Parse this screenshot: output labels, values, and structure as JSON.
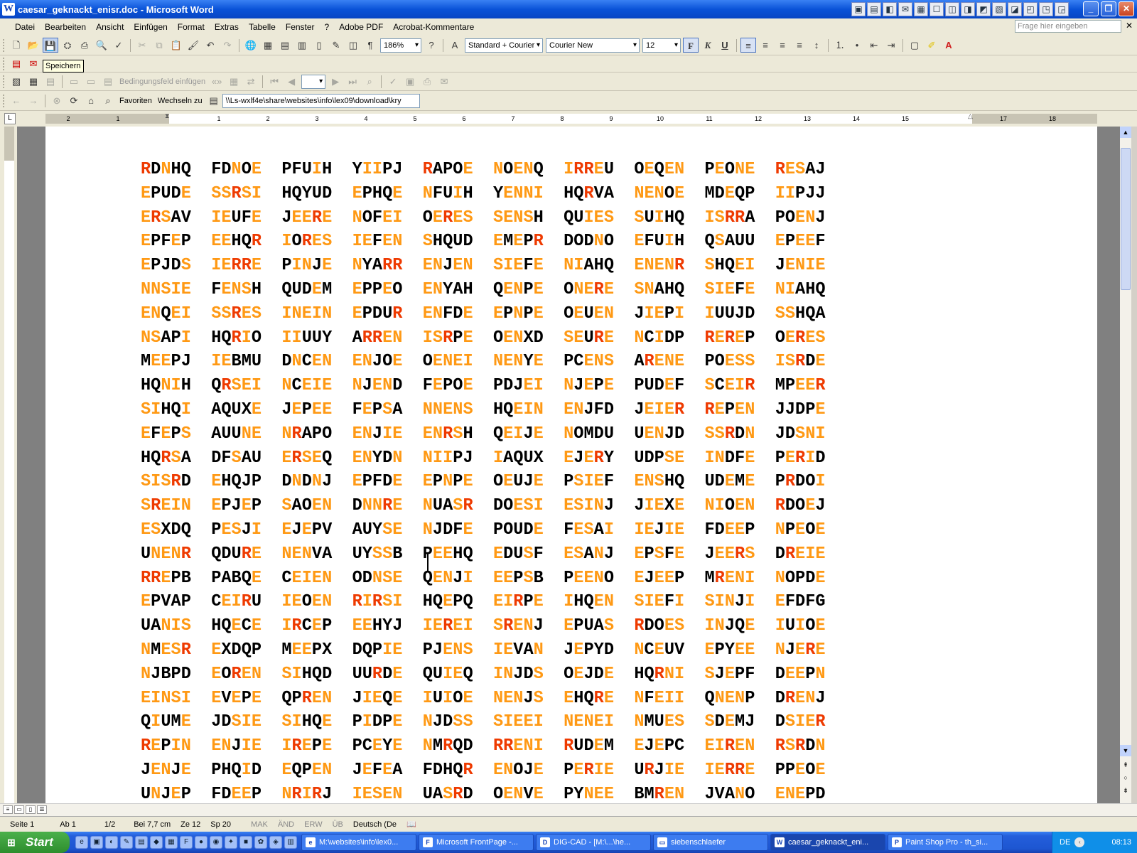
{
  "window": {
    "title": "caesar_geknackt_enisr.doc - Microsoft Word"
  },
  "menu": [
    "Datei",
    "Bearbeiten",
    "Ansicht",
    "Einfügen",
    "Format",
    "Extras",
    "Tabelle",
    "Fenster",
    "?",
    "Adobe PDF",
    "Acrobat-Kommentare"
  ],
  "ask_placeholder": "Frage hier eingeben",
  "toolbar": {
    "zoom": "186%",
    "style": "Standard + Courier",
    "font": "Courier New",
    "size": "12"
  },
  "tooltip": "Speichern",
  "mailmerge": {
    "field_label": "Bedingungsfeld einfügen"
  },
  "web": {
    "favorites": "Favoriten",
    "goto": "Wechseln zu",
    "address": "\\\\Ls-wxlf4e\\share\\websites\\info\\lex09\\download\\kry"
  },
  "ruler_numbers": [
    "2",
    "1",
    "1",
    "2",
    "3",
    "4",
    "5",
    "6",
    "7",
    "8",
    "9",
    "10",
    "11",
    "12",
    "13",
    "14",
    "15",
    "16",
    "17",
    "18"
  ],
  "colors": {
    "orange": "#ff9914",
    "red": "#ee3a00",
    "black": "#000000"
  },
  "cipher_rows": [
    "RDNHQ FDNOE PFUIH YIIPJ RAPOE NOENQ IRREU OEQEN PEONE RESAJ",
    "EPUDE SSRSI HQYUD EPHQE NFUIH YENNI HQRVA NENOE MDEQP IIPJJ",
    "ERSAV IEUFE JEERE NOFEI OERES SENSH QUIES SUIHQ ISRRA POENJ",
    "EPFEP EEHQR IORES IEFEN SHQUD EMEPR DODNO EFUIH QSAUU EPEEF",
    "EPJDS IERRE PINJE NYARR ENJEN SIEFE NIAHQ ENENR SHQEI JENIE",
    "NNSIE FENSH QUDEM EPPEO ENYAH QENPE ONERE SNAHQ SIEFE NIAHQ",
    "ENQEI SSRES INEIN EPDUR ENFDE EPNPE OEUEN JIEPI IUUJD SSHQA",
    "NSAPI HQRIO IIUUY ARREN ISRPE OENXD SEURE NCIDP REREP OERES",
    "MEEPJ IEBMU DNCEN ENJOE OENEI NENYE PCENS ARENE POESS ISRDE",
    "HQNIH QRSEI NCEIE NJEND FEPOE PDJEI NJEPE PUDEF SCEIR MPEER",
    "SIHQI AQUXE JEPEE FEPSA NNENS HQEIN ENJFD JEIER REPEN JJDPE",
    "EFEPS AUUNE NRAPO ENJIE ENRSH QEIJE NOMDU UENJD SSRDN JDSNI",
    "HQRSA DFSAU ERSEQ ENYDN NIIPJ IAQUX EJERY UDPSE INDFE PERID",
    "SISRD EHQJP DNDNJ EPFDE EPNPE OEUJE PSIEF ENSHQ UDEME PRDOI",
    "SREIN EPJEP SAOEN DNNRE NUASR DOESI ESINJ JIEXE NIOEN RDOEJ",
    "ESXDQ PESJI EJEPV AUYSE NJDFE POUDE FESAI IEJIE FDEEP NPEOE",
    "UNENR QDURE NENVA UYSSB PEEHQ EDUSF ESANJ EPSFE JEERS DREIE",
    "RREPB PABQE CEIEN ODNSE QENJI EEPSB PEENO EJEEP MRENI NOPDE",
    "EPVAP CEIRU IEOEN RIRSI HQEPQ EIRPE IHQEN SIEFI SINJI EFDFG",
    "UANIS HQECE IRCEP EEHYJ IEREI SRENJ EPUAS RDOES INJQE IUIOE",
    "NMESR EXDQP MEEPX DQPIE PJENS IEVAN JEPYD NCEUV EPYEE NJERE",
    "NJBPD EOREN SIHQD UURDE QUIEQ INJDS OEJDE HQRNI SJEPF DEEPN",
    "EINSI EVEPE QPREN JIEQE IUIOE NENJS EHQRE NFEII QNENP DRENJ",
    "QIUME JDSIE SIHQE PIDPE NJDSS SIEEI NENEI NMUES SDEMJ DSIER",
    "REPIN ENJIE IREPE PCEYE NMRQD RRENI RUDEM EJEPC EIREN RSRDN",
    "JENJE PHQID EQPEN JEFEA FDHQR ENOJE PERIE URJIE IERRE PPEOE",
    "UNJEP FDEEP NRIRJ IESEN UASRD OENVE PYNEE BMREN JVANO ENEPD"
  ],
  "status": [
    "Seite 1",
    "Ab 1",
    "1/2",
    "Bei 7,7 cm",
    "Ze 12",
    "Sp 20",
    "MAK",
    "ÄND",
    "ERW",
    "ÜB",
    "Deutsch (De"
  ],
  "taskbar": {
    "start": "Start",
    "items": [
      "M:\\websites\\info\\lex0...",
      "Microsoft FrontPage -...",
      "DIG-CAD - [M:\\...\\he...",
      "siebenschlaefer",
      "caesar_geknackt_eni...",
      "Paint Shop Pro - th_si..."
    ],
    "lang": "DE",
    "clock": "08:13"
  }
}
